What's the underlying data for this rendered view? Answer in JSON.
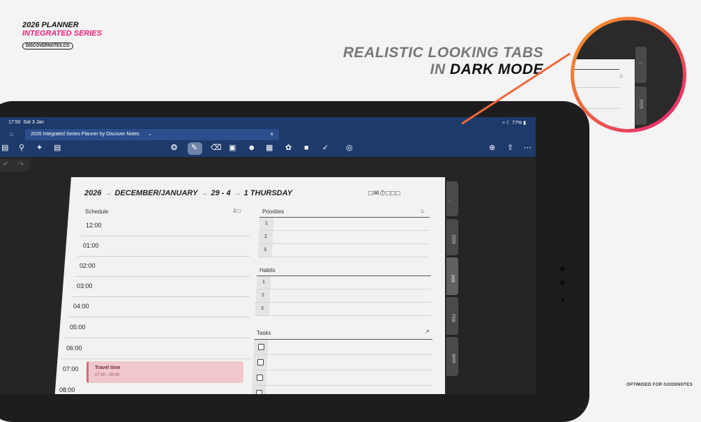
{
  "brand": {
    "line1": "2026 PLANNER",
    "line2": "INTEGRATED SERIES",
    "site": "DISCOVERNOTES.CO"
  },
  "headline": {
    "line1": "REALISTIC LOOKING TABS",
    "line2_prefix": "IN ",
    "line2_emph": "DARK MODE"
  },
  "footnote": "OPTIMISED FOR GOODNOTES",
  "status": {
    "time": "17:50",
    "date": "Sat 3 Jan",
    "battery": "77%"
  },
  "tab": {
    "title": "2026 Integrated Series Planner by Discover Notes"
  },
  "page": {
    "year": "2026",
    "month": "DECEMBER/JANUARY",
    "week": "29 - 4",
    "day": "1 THURSDAY",
    "schedule_title": "Schedule",
    "priorities_title": "Priorities",
    "habits_title": "Habits",
    "tasks_title": "Tasks",
    "times": [
      "12:00",
      "01:00",
      "02:00",
      "03:00",
      "04:00",
      "05:00",
      "06:00",
      "07:00",
      "08:00"
    ],
    "priorities": [
      "1",
      "2",
      "3"
    ],
    "habits": [
      "1",
      "2",
      "3"
    ],
    "event": {
      "title": "Travel time",
      "range": "07:00 - 08:00"
    }
  },
  "side_tabs": [
    "...",
    "2026",
    "JAN",
    "FEB",
    "MAR"
  ],
  "colors": {
    "accent_pink": "#e8207a",
    "accent_orange": "#f06a3b",
    "toolbar_blue": "#1e3a6b"
  }
}
